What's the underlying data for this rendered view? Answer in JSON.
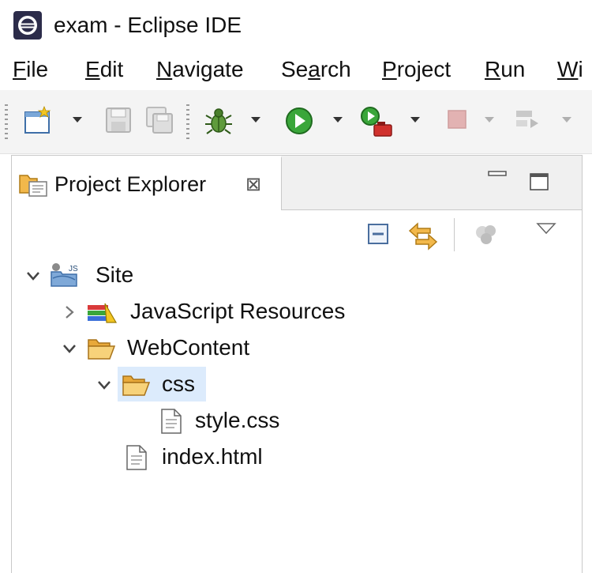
{
  "window": {
    "title": "exam - Eclipse IDE"
  },
  "menu": [
    {
      "id": "file",
      "mnemonic": "F",
      "rest": "ile"
    },
    {
      "id": "edit",
      "mnemonic": "E",
      "rest": "dit"
    },
    {
      "id": "navigate",
      "mnemonic": "N",
      "rest": "avigate"
    },
    {
      "id": "search",
      "pre": "Se",
      "mnemonic": "a",
      "rest": "rch"
    },
    {
      "id": "project",
      "mnemonic": "P",
      "rest": "roject"
    },
    {
      "id": "run",
      "mnemonic": "R",
      "rest": "un"
    },
    {
      "id": "window",
      "mnemonic": "W",
      "rest": "i"
    }
  ],
  "toolbar": {
    "icons": [
      "new-wizard-icon",
      "save-icon",
      "save-all-icon",
      "debug-icon",
      "run-icon",
      "run-external-tools-icon",
      "terminate-icon",
      "next-annotation-icon"
    ]
  },
  "view": {
    "tab_label": "Project Explorer",
    "tab_close": "⊠",
    "view_toolbar_icons": [
      "collapse-all-icon",
      "link-with-editor-icon",
      "filter-icon",
      "view-menu-icon"
    ]
  },
  "tree": [
    {
      "label": "Site",
      "expanded": true,
      "icon": "web-project-icon"
    },
    {
      "label": "JavaScript Resources",
      "expanded": false,
      "icon": "library-icon"
    },
    {
      "label": "WebContent",
      "expanded": true,
      "icon": "open-folder-icon"
    },
    {
      "label": "css",
      "expanded": true,
      "icon": "open-folder-icon",
      "selected": true
    },
    {
      "label": "style.css",
      "icon": "file-icon"
    },
    {
      "label": "index.html",
      "icon": "file-icon"
    }
  ],
  "colors": {
    "selection": "#dcebfc",
    "folder": "#f2b84b",
    "run_green": "#3aa63a",
    "terminate_red": "#d0312d"
  }
}
